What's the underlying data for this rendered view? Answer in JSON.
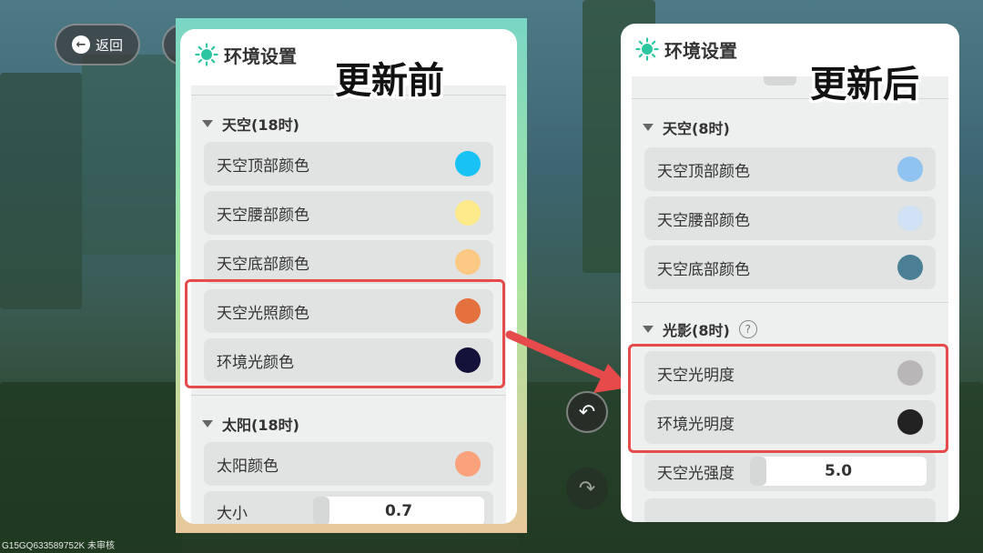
{
  "top_bar": {
    "back_label": "返回"
  },
  "watermark": "G15GQ633589752K 未审核",
  "colors": {
    "highlight": "#e64a4a",
    "sun_icon": "#2cc6a0",
    "arrow": "#e64a4a"
  },
  "left_panel": {
    "title": "环境设置",
    "overlay_label": "更新前",
    "sections": [
      {
        "title": "天空(18时)",
        "rows": [
          {
            "label": "天空顶部颜色",
            "color": "#19c2f5"
          },
          {
            "label": "天空腰部颜色",
            "color": "#fdea8a"
          },
          {
            "label": "天空底部颜色",
            "color": "#fcc985"
          },
          {
            "label": "天空光照颜色",
            "color": "#e5723e"
          },
          {
            "label": "环境光颜色",
            "color": "#14123a"
          }
        ]
      },
      {
        "title": "太阳(18时)",
        "rows": [
          {
            "label": "太阳颜色",
            "color": "#f9a27c"
          }
        ],
        "partial_label": "大小",
        "partial_value": "0.7"
      }
    ]
  },
  "right_panel": {
    "title": "环境设置",
    "overlay_label": "更新后",
    "sections": [
      {
        "title": "天空(8时)",
        "rows": [
          {
            "label": "天空顶部颜色",
            "color": "#8fc3f0"
          },
          {
            "label": "天空腰部颜色",
            "color": "#cfe1f2"
          },
          {
            "label": "天空底部颜色",
            "color": "#4b7f95"
          }
        ]
      },
      {
        "title": "光影(8时)",
        "help": "?",
        "rows": [
          {
            "label": "天空光明度",
            "color": "#b8b6b6"
          },
          {
            "label": "环境光明度",
            "color": "#222222"
          }
        ],
        "slider": {
          "label": "天空光强度",
          "value": "5.0"
        }
      }
    ]
  }
}
